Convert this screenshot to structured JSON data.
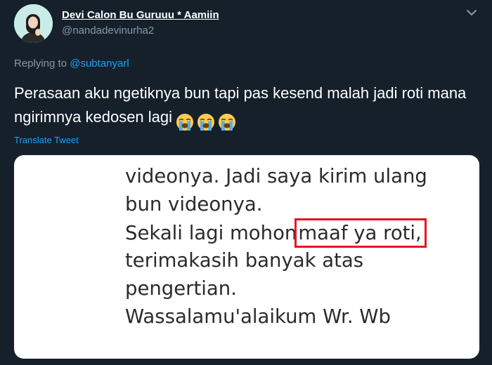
{
  "author": {
    "display_name": "Devi Calon Bu Guruuu * Aamiin",
    "handle": "@nandadevinurha2"
  },
  "reply": {
    "prefix": "Replying to",
    "mention": "@subtanyarl"
  },
  "tweet": {
    "text": "Perasaan aku ngetiknya bun tapi pas kesend malah jadi roti mana ngirimnya kedosen lagi",
    "emoji": [
      "loudly-crying-face",
      "loudly-crying-face",
      "loudly-crying-face"
    ]
  },
  "translate_label": "Translate Tweet",
  "media": {
    "lines": [
      "videonya. Jadi saya kirim ulang",
      "bun videonya.",
      "Sekali lagi mohon",
      "terimakasih banyak atas",
      "pengertian.",
      "Wassalamu'alaikum Wr. Wb"
    ],
    "highlighted_text": "maaf ya roti,",
    "highlight_color": "#e8141f"
  },
  "colors": {
    "background": "#15202b",
    "secondary_text": "#8899a6",
    "link": "#1da1f2"
  }
}
